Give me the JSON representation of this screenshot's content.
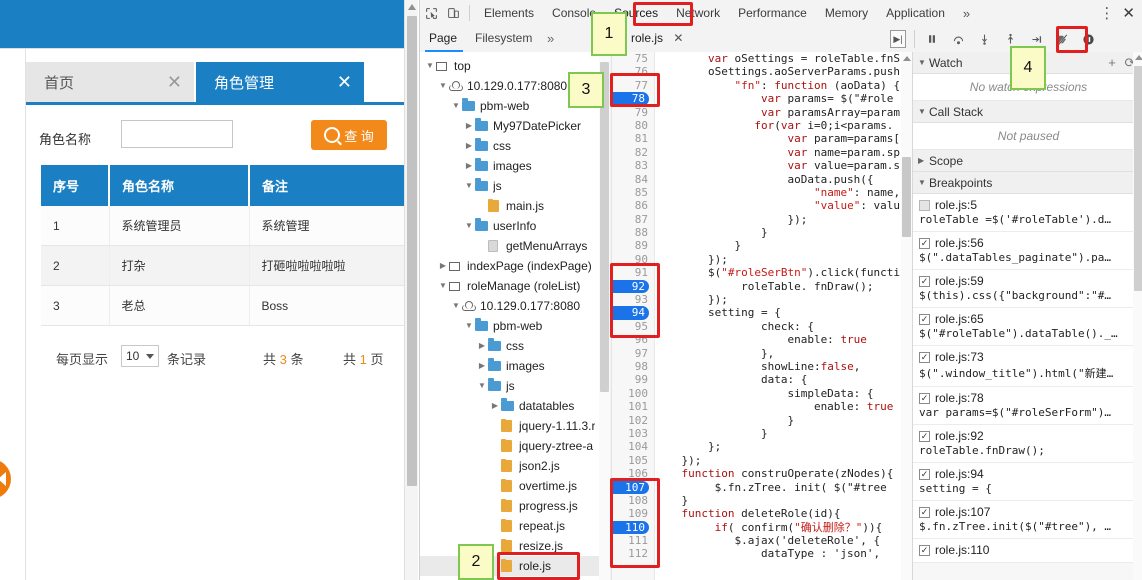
{
  "webpage": {
    "tabs": [
      {
        "label": "首页",
        "close": "✕",
        "active": false
      },
      {
        "label": "角色管理",
        "close": "✕",
        "active": true
      }
    ],
    "search": {
      "label": "角色名称",
      "value": "",
      "placeholder": "",
      "button_label": "查 询",
      "button_icon": "search-icon",
      "button_color": "#f18a1b"
    },
    "table": {
      "headers": [
        "序号",
        "角色名称",
        "备注"
      ],
      "rows": [
        [
          "1",
          "系统管理员",
          "系统管理"
        ],
        [
          "2",
          "打杂",
          "打砸啦啦啦啦啦"
        ],
        [
          "3",
          "老总",
          "Boss"
        ]
      ],
      "header_color": "#1b7fc3"
    },
    "pager": {
      "prefix": "每页显示",
      "page_size": "10",
      "suffix": "条记录",
      "total_prefix": "共",
      "total_count": "3",
      "total_suffix": "条",
      "pages_prefix": "共",
      "pages_count": "1",
      "pages_suffix": "页"
    },
    "collapse_handle_icon": "left-arrow-icon"
  },
  "devtools": {
    "toolbar": {
      "inspect_icon": "inspect-element-icon",
      "device_icon": "device-toolbar-icon",
      "tabs": [
        "Elements",
        "Console",
        "Sources",
        "Network",
        "Performance",
        "Memory",
        "Application"
      ],
      "selected_tab": "Sources",
      "overflow": "»",
      "kebab": "⋮",
      "close": "✕"
    },
    "subtoolbar": {
      "page_tab": "Page",
      "filesystem_tab": "Filesystem",
      "more": "»",
      "collapse_icon": "collapse-sidebar-icon",
      "open_file": "role.js",
      "open_file_close": "✕",
      "expand_icon": "expand-sidebar-icon",
      "debug_buttons": [
        {
          "name": "pause-script-button",
          "glyph": "❚❚"
        },
        {
          "name": "step-over-button",
          "glyph": "↷"
        },
        {
          "name": "step-into-button",
          "glyph": "↓"
        },
        {
          "name": "step-out-button",
          "glyph": "↑"
        },
        {
          "name": "step-button",
          "glyph": "→|"
        },
        {
          "name": "deactivate-breakpoints-button",
          "glyph": "▮/"
        },
        {
          "name": "pause-on-exceptions-button",
          "glyph": "⏸"
        }
      ]
    },
    "filetree": [
      {
        "depth": 0,
        "twisty": "▼",
        "icon": "frame-icon",
        "label": "top"
      },
      {
        "depth": 1,
        "twisty": "▼",
        "icon": "cloud-icon",
        "label": "10.129.0.177:8080"
      },
      {
        "depth": 2,
        "twisty": "▼",
        "icon": "folder-icon",
        "label": "pbm-web"
      },
      {
        "depth": 3,
        "twisty": "▶",
        "icon": "folder-icon",
        "label": "My97DatePicker"
      },
      {
        "depth": 3,
        "twisty": "▶",
        "icon": "folder-icon",
        "label": "css"
      },
      {
        "depth": 3,
        "twisty": "▶",
        "icon": "folder-icon",
        "label": "images"
      },
      {
        "depth": 3,
        "twisty": "▼",
        "icon": "folder-icon",
        "label": "js"
      },
      {
        "depth": 4,
        "twisty": "",
        "icon": "js-file-icon",
        "label": "main.js"
      },
      {
        "depth": 3,
        "twisty": "▼",
        "icon": "folder-icon",
        "label": "userInfo"
      },
      {
        "depth": 4,
        "twisty": "",
        "icon": "doc-file-icon",
        "label": "getMenuArrays"
      },
      {
        "depth": 1,
        "twisty": "▶",
        "icon": "frame-icon",
        "label": "indexPage (indexPage)"
      },
      {
        "depth": 1,
        "twisty": "▼",
        "icon": "frame-icon",
        "label": "roleManage (roleList)"
      },
      {
        "depth": 2,
        "twisty": "▼",
        "icon": "cloud-icon",
        "label": "10.129.0.177:8080"
      },
      {
        "depth": 3,
        "twisty": "▼",
        "icon": "folder-icon",
        "label": "pbm-web"
      },
      {
        "depth": 4,
        "twisty": "▶",
        "icon": "folder-icon",
        "label": "css"
      },
      {
        "depth": 4,
        "twisty": "▶",
        "icon": "folder-icon",
        "label": "images"
      },
      {
        "depth": 4,
        "twisty": "▼",
        "icon": "folder-icon",
        "label": "js"
      },
      {
        "depth": 5,
        "twisty": "▶",
        "icon": "folder-icon",
        "label": "datatables"
      },
      {
        "depth": 5,
        "twisty": "",
        "icon": "js-file-icon",
        "label": "jquery-1.11.3.r"
      },
      {
        "depth": 5,
        "twisty": "",
        "icon": "js-file-icon",
        "label": "jquery-ztree-a"
      },
      {
        "depth": 5,
        "twisty": "",
        "icon": "js-file-icon",
        "label": "json2.js"
      },
      {
        "depth": 5,
        "twisty": "",
        "icon": "js-file-icon",
        "label": "overtime.js"
      },
      {
        "depth": 5,
        "twisty": "",
        "icon": "js-file-icon",
        "label": "progress.js"
      },
      {
        "depth": 5,
        "twisty": "",
        "icon": "js-file-icon",
        "label": "repeat.js"
      },
      {
        "depth": 5,
        "twisty": "",
        "icon": "js-file-icon",
        "label": "resize.js"
      },
      {
        "depth": 5,
        "twisty": "",
        "icon": "js-file-icon",
        "label": "role.js",
        "selected": true
      }
    ],
    "code": {
      "first_line": 75,
      "breakpoint_lines": [
        78,
        92,
        94,
        107,
        110
      ],
      "lines": [
        "        var oSettings = roleTable.fnS",
        "        oSettings.aoServerParams.push",
        "            \"fn\": function (aoData) {",
        "                var params= $(\"#role",
        "                var paramsArray=param",
        "               for(var i=0;i<params.",
        "                    var param=params[",
        "                    var name=param.sp",
        "                    var value=param.s",
        "                    aoData.push({",
        "                        \"name\": name,",
        "                        \"value\": valu",
        "                    });",
        "                }",
        "            }",
        "        });",
        "        $(\"#roleSerBtn\").click(functi",
        "             roleTable. fnDraw();",
        "        });",
        "        setting = {",
        "                check: {",
        "                    enable: true",
        "                },",
        "                showLine:false,",
        "                data: {",
        "                    simpleData: {",
        "                        enable: true",
        "                    }",
        "                }",
        "        };",
        "    });",
        "    function construOperate(zNodes){",
        "         $.fn.zTree. init( $(\"#tree",
        "    }",
        "    function deleteRole(id){",
        "         if( confirm(\"确认删除？\")){",
        "            $.ajax('deleteRole', {",
        "                dataType : 'json',"
      ]
    },
    "sidebar": {
      "watch": {
        "title": "Watch",
        "empty": "No watch expressions",
        "add": "+",
        "refresh": "⟳"
      },
      "callstack": {
        "title": "Call Stack",
        "empty": "Not paused"
      },
      "scope": {
        "title": "Scope"
      },
      "breakpoints_title": "Breakpoints",
      "breakpoints": [
        {
          "name": "role.js:5",
          "code": "roleTable =$('#roleTable').d…",
          "checked": false
        },
        {
          "name": "role.js:56",
          "code": "$(\".dataTables_paginate\").pa…",
          "checked": true
        },
        {
          "name": "role.js:59",
          "code": "$(this).css({\"background\":\"#…",
          "checked": true
        },
        {
          "name": "role.js:65",
          "code": "$(\"#roleTable\").dataTable()._…",
          "checked": true
        },
        {
          "name": "role.js:73",
          "code": "$(\".window_title\").html(\"新建…",
          "checked": true
        },
        {
          "name": "role.js:78",
          "code": "var params=$(\"#roleSerForm\")…",
          "checked": true
        },
        {
          "name": "role.js:92",
          "code": "roleTable.fnDraw();",
          "checked": true
        },
        {
          "name": "role.js:94",
          "code": "setting = {",
          "checked": true
        },
        {
          "name": "role.js:107",
          "code": "$.fn.zTree.init($(\"#tree\"), …",
          "checked": true
        },
        {
          "name": "role.js:110",
          "code": "",
          "checked": true
        }
      ]
    }
  },
  "annotations": [
    {
      "number": "1",
      "target": "sources-tab"
    },
    {
      "number": "2",
      "target": "role-js-file"
    },
    {
      "number": "3",
      "target": "breakpoint-line-78"
    },
    {
      "number": "4",
      "target": "deactivate-breakpoints-button"
    }
  ]
}
